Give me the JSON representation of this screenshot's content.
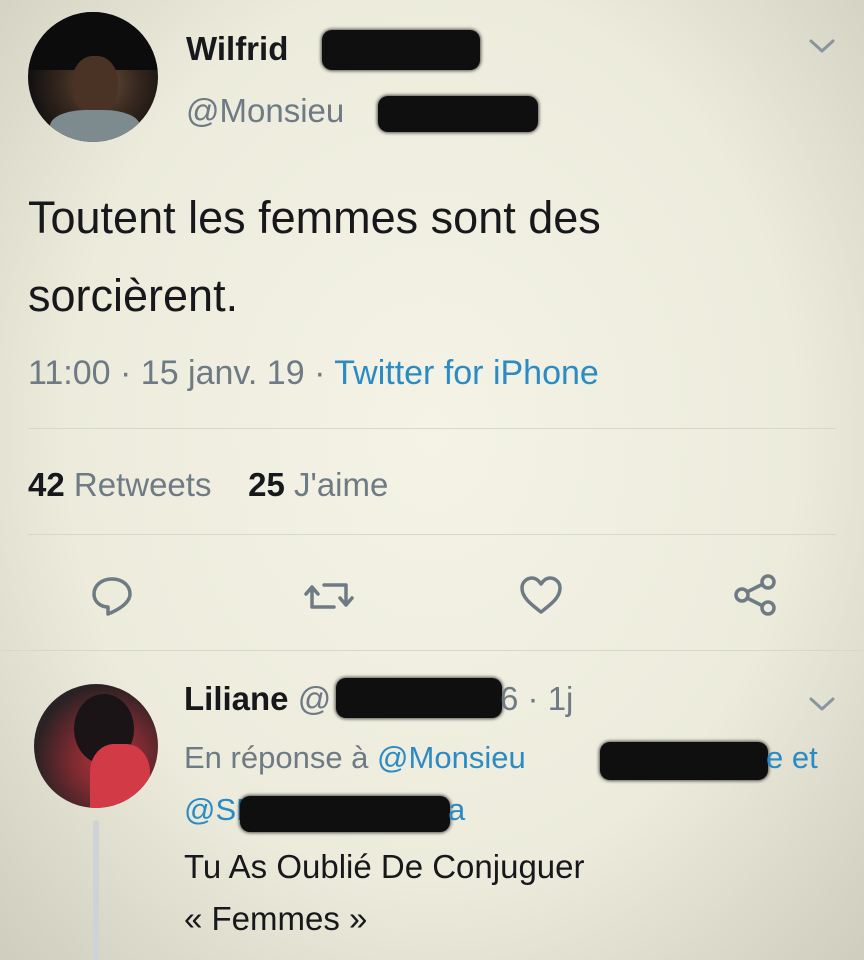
{
  "tweet": {
    "author_name": "Wilfrid",
    "author_handle": "@Monsieu",
    "text_line1": "Toutent les femmes sont des",
    "text_line2": "sorcièrent.",
    "time": "11:00",
    "sep1": "·",
    "date": "15 janv. 19",
    "sep2": "·",
    "source": "Twitter for iPhone",
    "retweets_count": "42",
    "retweets_label": "Retweets",
    "likes_count": "25",
    "likes_label": "J'aime"
  },
  "reply": {
    "author_name": "Liliane",
    "handle_start": "@",
    "handle_end": "6",
    "sep": "·",
    "age": "1j",
    "in_reply_label": "En réponse à",
    "mention1": "@Monsieu",
    "mention1_tail": "e",
    "and_label": "et",
    "mention2": "@SM",
    "mention2_tail": "a",
    "text_line1": "Tu As Oublié De Conjuguer",
    "text_line2": "« Femmes »"
  },
  "icons": {
    "header": "chevron-down-icon",
    "actions": [
      "reply-icon",
      "retweet-icon",
      "like-icon",
      "share-icon"
    ]
  },
  "colors": {
    "link": "#2b8bc4",
    "secondary_text": "#6e7a84",
    "primary_text": "#16181b"
  }
}
